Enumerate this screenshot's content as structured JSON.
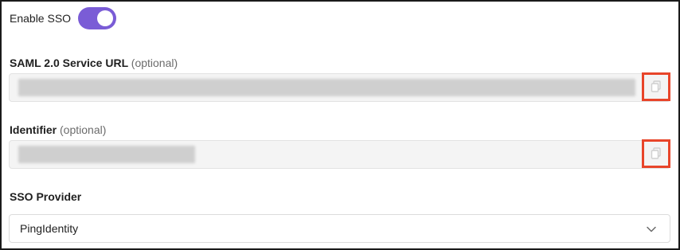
{
  "sso_toggle": {
    "label": "Enable SSO",
    "enabled": true,
    "accent": "#7a5cd6"
  },
  "service_url": {
    "label": "SAML 2.0 Service URL",
    "optional": "(optional)",
    "copy_icon": "copy-icon"
  },
  "identifier": {
    "label": "Identifier",
    "optional": "(optional)",
    "copy_icon": "copy-icon"
  },
  "provider": {
    "label": "SSO Provider",
    "value": "PingIdentity",
    "dropdown_icon": "chevron-down-icon"
  },
  "highlight_color": "#e8452a"
}
